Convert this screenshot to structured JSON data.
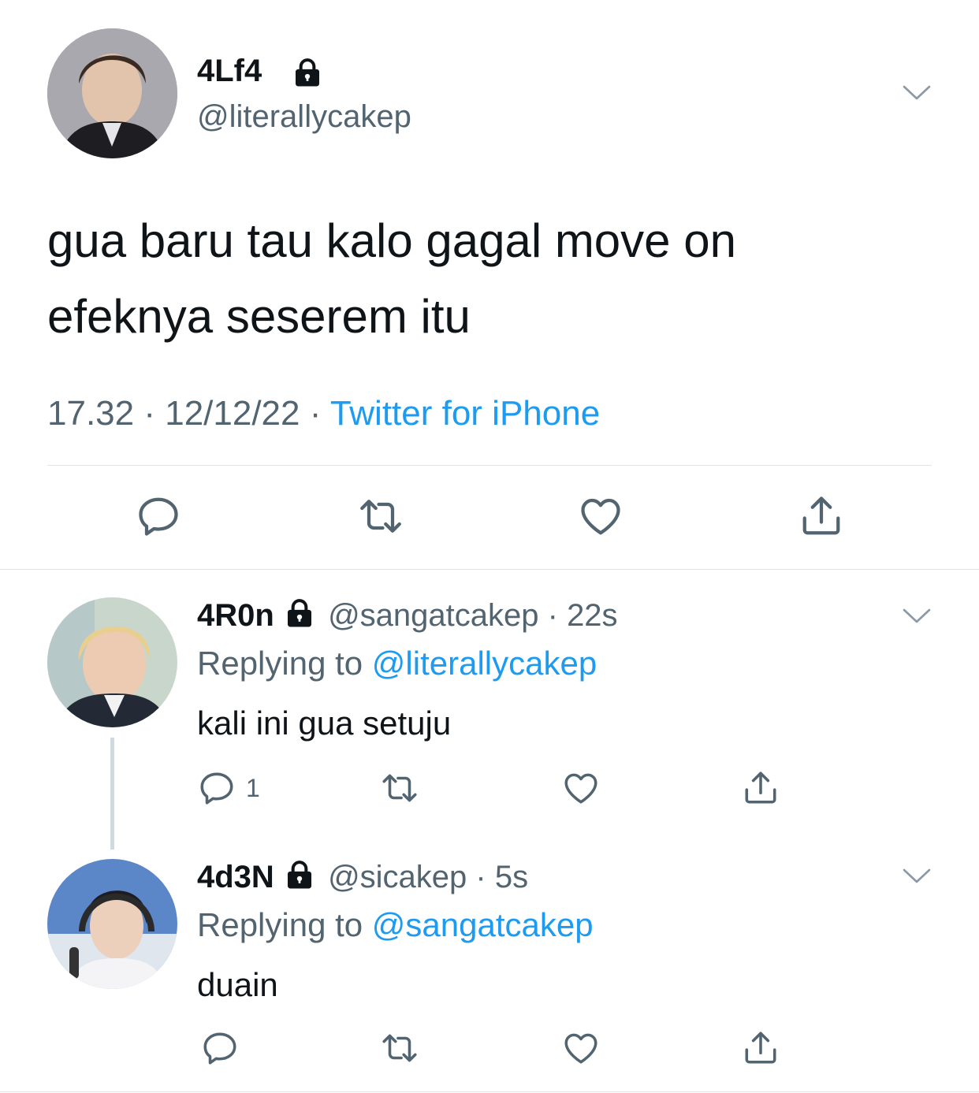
{
  "main_tweet": {
    "display_name": "4Lf4",
    "handle": "@literallycakep",
    "text_line1": "gua baru tau kalo gagal move on",
    "text_line2": "efeknya seserem itu",
    "time": "17.32",
    "date": "12/12/22",
    "source": "Twitter for iPhone",
    "separator": " · "
  },
  "replies": [
    {
      "display_name": "4R0n",
      "handle": "@sangatcakep",
      "age": "22s",
      "replying_prefix": "Replying to ",
      "replying_to": "@literallycakep",
      "text": "kali ini gua setuju",
      "reply_count": "1"
    },
    {
      "display_name": "4d3N",
      "handle": "@sicakep",
      "age": "5s",
      "replying_prefix": "Replying to ",
      "replying_to": "@sangatcakep",
      "text": "duain",
      "reply_count": ""
    }
  ],
  "icons": {
    "lock": "lock-icon",
    "chevron": "chevron-down-icon",
    "reply": "reply-icon",
    "retweet": "retweet-icon",
    "like": "like-icon",
    "share": "share-icon"
  },
  "colors": {
    "link": "#1d9bf0",
    "secondary_text": "#536471",
    "divider": "#dfe3e6"
  }
}
